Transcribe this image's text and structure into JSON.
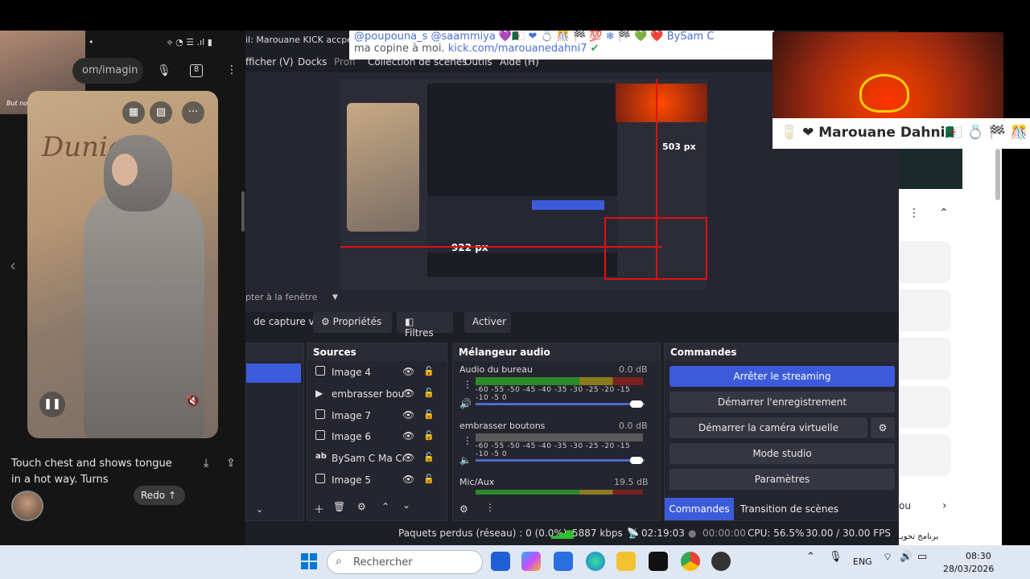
{
  "phone": {
    "url_text": "om/imagin",
    "caption": "Touch chest and shows tongue in a hot way. Turns",
    "redo_label": "Redo",
    "video_title": "Dunia",
    "ghost_text": "But nobody to be found"
  },
  "obs": {
    "window_title_fragment": "il: Marouane KICK accpetab",
    "menu": [
      "fficher (V)",
      "Docks",
      "Profi",
      "Collection de scènes",
      "Outils",
      "Aide (H)"
    ],
    "canvas_label": "pter à la fenêtre",
    "toolbar": {
      "capture_label": "de capture vic",
      "properties": "Propriétés",
      "filters": "Filtres",
      "activate": "Activer"
    },
    "sources": {
      "title": "Sources",
      "items": [
        "Image 4",
        "embrasser bout",
        "Image 7",
        "Image 6",
        "BySam C Ma Co",
        "Image 5"
      ]
    },
    "mixer": {
      "title": "Mélangeur audio",
      "channels": [
        {
          "name": "Audio du bureau",
          "db": "0.0 dB"
        },
        {
          "name": "embrasser boutons",
          "db": "0.0 dB"
        },
        {
          "name": "Mic/Aux",
          "db": "19.5 dB"
        }
      ],
      "scale": "-60 -55 -50 -45 -40 -35 -30 -25 -20 -15 -10 -5 0"
    },
    "commands": {
      "title": "Commandes",
      "stop_streaming": "Arrêter le streaming",
      "start_recording": "Démarrer l'enregistrement",
      "start_virtual_cam": "Démarrer la caméra virtuelle",
      "studio_mode": "Mode studio",
      "settings": "Paramètres",
      "tab_commands": "Commandes",
      "tab_transitions": "Transition de scènes"
    },
    "status": {
      "dropped": "Paquets perdus (réseau) : 0 (0.0%)",
      "bitrate": "5887 kbps",
      "stream_time": "02:19:03",
      "record_time": "00:00:00",
      "cpu": "CPU: 56.5%",
      "fps": "30.00 / 30.00 FPS"
    },
    "preview_labels": {
      "px_a": "922 px",
      "px_b": "503 px"
    },
    "accent": "#3b5bdb"
  },
  "overlay": {
    "comment_line1": "@poupouna_s  @saammiya 💜🇩🇿 ❤ 💍 🎊 🏁 💯 ❄ 🏁 💚 ❤️ BySam C",
    "comment_line2_prefix": "ma copine à moi. ",
    "comment_link": "kick.com/marouanedahni7",
    "name_bar": "🥛 ❤ Marouane Dahni🇩🇿 💍 🏁 🎊"
  },
  "right_panel": {
    "text_frag": "ou",
    "arabic": "برنامج تحويـ"
  },
  "taskbar": {
    "search_placeholder": "Rechercher",
    "lang": "ENG",
    "time": "08:30",
    "date": "28/03/2026"
  }
}
